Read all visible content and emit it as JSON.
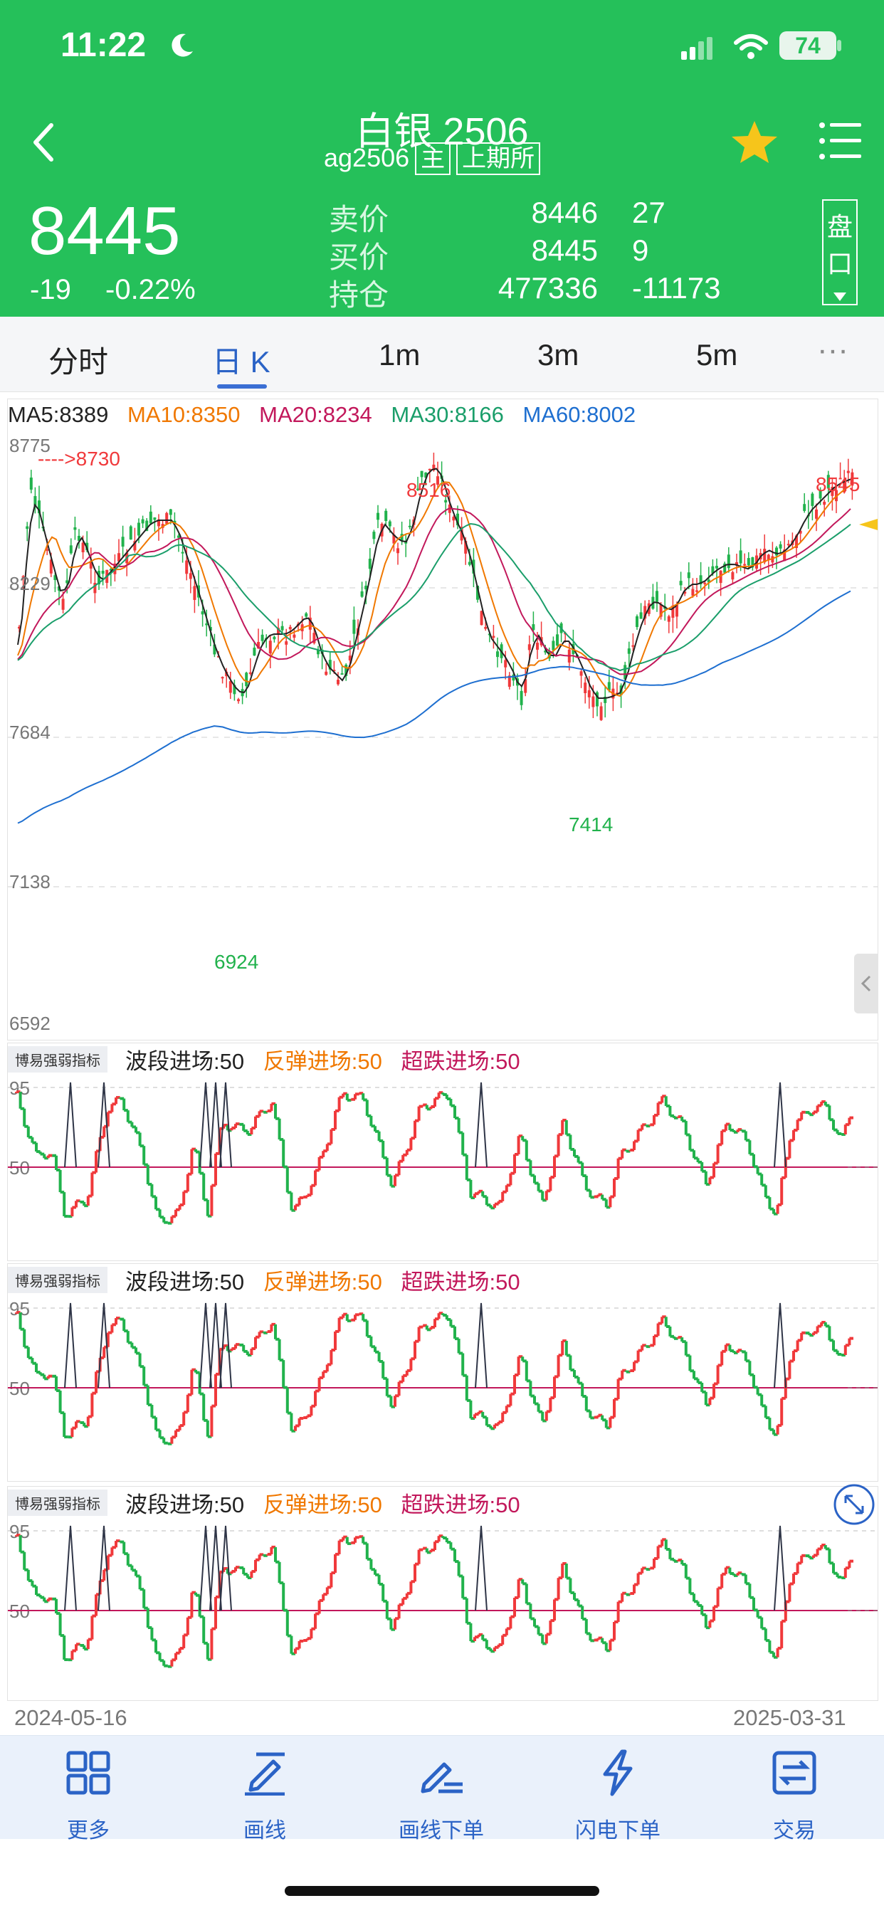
{
  "status_bar": {
    "time": "11:22",
    "battery": "74"
  },
  "header": {
    "title": "白银 2506",
    "code": "ag2506",
    "tag_main": "主",
    "tag_exchange": "上期所",
    "price": "8445",
    "change": "-19",
    "change_pct": "-0.22%",
    "quote_labels": [
      "卖价",
      "买价",
      "持仓"
    ],
    "quote_values": [
      "8446",
      "8445",
      "477336"
    ],
    "quote_side": [
      "27",
      "9",
      "-11173"
    ],
    "pan_label": "盘口",
    "pan_label_chars": [
      "盘",
      "口"
    ]
  },
  "tabs": [
    "分时",
    "日 K",
    "1m",
    "3m",
    "5m",
    "···"
  ],
  "active_tab": "日 K",
  "main_chart": {
    "ma_legend": [
      {
        "label": "MA5:8389",
        "color": "#222222"
      },
      {
        "label": "MA10:8350",
        "color": "#f07800"
      },
      {
        "label": "MA20:8234",
        "color": "#c2185b"
      },
      {
        "label": "MA30:8166",
        "color": "#1a9e6a"
      },
      {
        "label": "MA60:8002",
        "color": "#1e6fd0"
      }
    ],
    "y_ticks": [
      "8775",
      "8229",
      "7684",
      "7138",
      "6592"
    ],
    "annotations": {
      "arrow_high": "---->8730",
      "high_1": "8516",
      "high_2": "8545",
      "low_1": "6924",
      "low_2": "7414"
    },
    "colors": {
      "up": "#f0393b",
      "down": "#21b24c"
    }
  },
  "indicators": {
    "name": "博易强弱指标",
    "items": [
      {
        "label": "波段进场:50",
        "color": "#222222"
      },
      {
        "label": "反弹进场:50",
        "color": "#f07800"
      },
      {
        "label": "超跌进场:50",
        "color": "#c2185b"
      }
    ],
    "y_ticks": [
      "95",
      "50"
    ]
  },
  "dates": {
    "start": "2024-05-16",
    "end": "2025-03-31"
  },
  "bottom_nav": [
    {
      "label": "更多",
      "icon": "grid-icon"
    },
    {
      "label": "画线",
      "icon": "pen-line-icon"
    },
    {
      "label": "画线下单",
      "icon": "pen-order-icon"
    },
    {
      "label": "闪电下单",
      "icon": "lightning-icon"
    },
    {
      "label": "交易",
      "icon": "exchange-icon"
    }
  ]
}
